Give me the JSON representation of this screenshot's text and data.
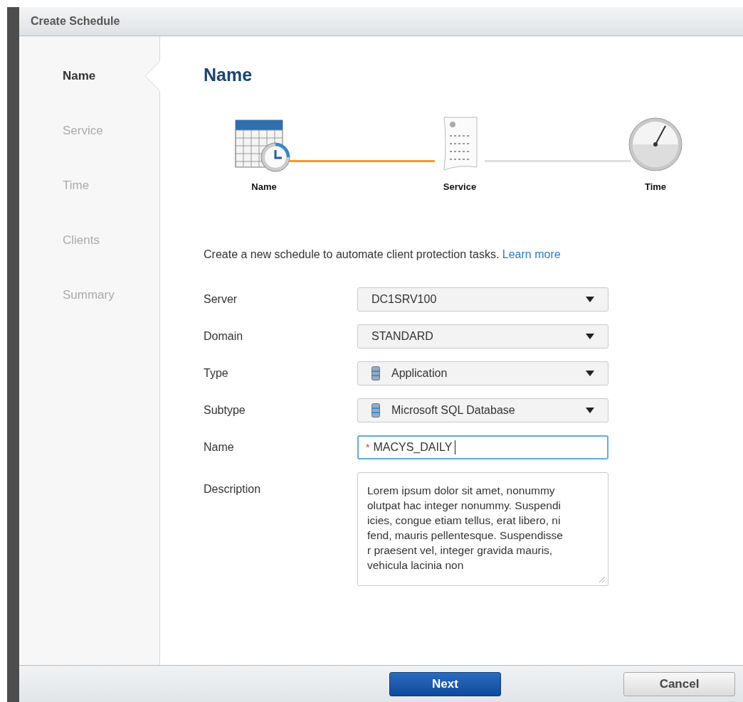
{
  "dialog": {
    "title": "Create Schedule"
  },
  "sidebar": {
    "items": [
      {
        "label": "Name",
        "selected": true
      },
      {
        "label": "Service",
        "selected": false
      },
      {
        "label": "Time",
        "selected": false
      },
      {
        "label": "Clients",
        "selected": false
      },
      {
        "label": "Summary",
        "selected": false
      }
    ]
  },
  "heading": "Name",
  "steps": [
    {
      "label": "Name",
      "kind": "calendar"
    },
    {
      "label": "Service",
      "kind": "document"
    },
    {
      "label": "Time",
      "kind": "clock"
    }
  ],
  "connectors": [
    {
      "active": true
    },
    {
      "active": false
    }
  ],
  "intro": {
    "text": "Create a new schedule to automate client protection tasks.",
    "link": "Learn more"
  },
  "form": [
    {
      "label": "Server",
      "kind": "select",
      "value": "DC1SRV100",
      "has_icon": false
    },
    {
      "label": "Domain",
      "kind": "select",
      "value": "STANDARD",
      "has_icon": false
    },
    {
      "label": "Type",
      "kind": "select",
      "value": "Application",
      "has_icon": true
    },
    {
      "label": "Subtype",
      "kind": "select",
      "value": "Microsoft SQL Database",
      "has_icon": true
    },
    {
      "label": "Name",
      "kind": "text",
      "value": "MACYS_DAILY",
      "required_mark": "*",
      "focused": true
    },
    {
      "label": "Description",
      "kind": "textarea",
      "lines": [
        "Lorem ipsum dolor sit amet, nonummy",
        "olutpat hac integer nonummy. Suspendi",
        "icies, congue etiam tellus, erat libero, ni",
        "fend, mauris pellentesque. Suspendisse",
        "r praesent vel, integer gravida mauris,",
        "vehicula lacinia non"
      ]
    }
  ],
  "buttons": [
    {
      "label": "Next",
      "kind": "primary"
    },
    {
      "label": "Cancel",
      "kind": "secondary"
    }
  ]
}
